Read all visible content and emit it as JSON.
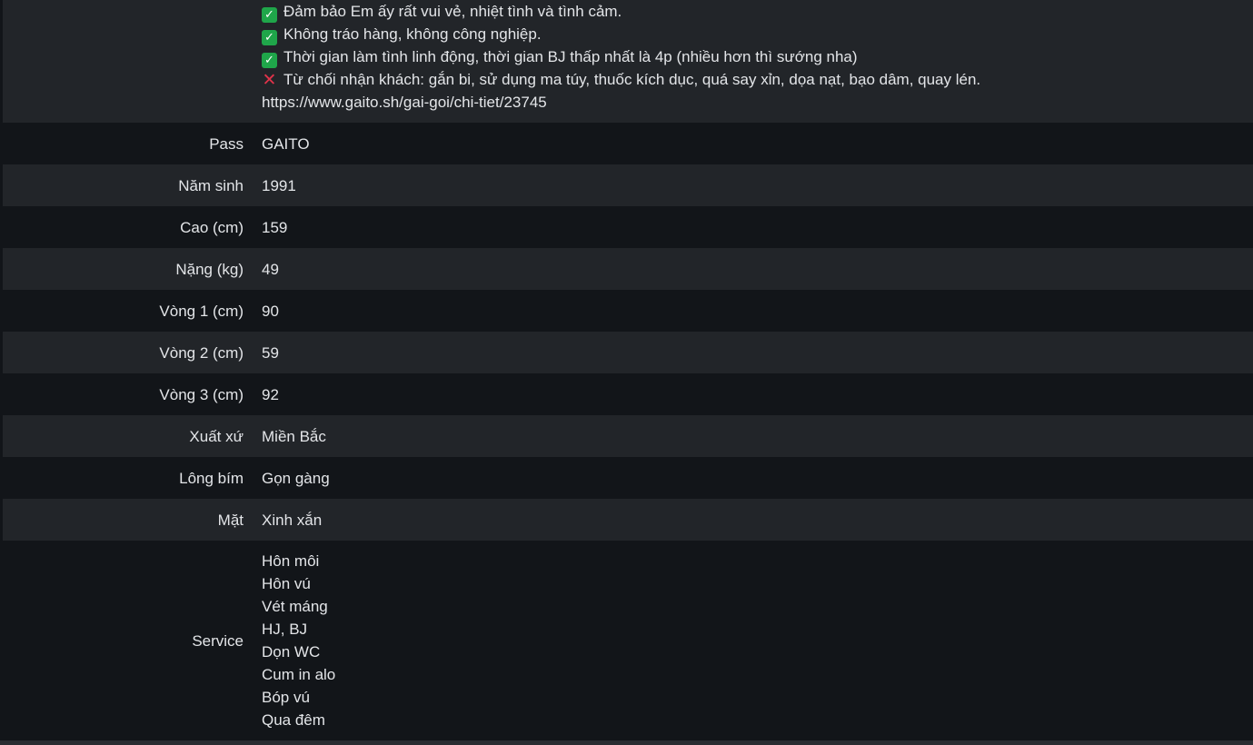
{
  "description": {
    "lines": [
      {
        "icon": "check",
        "text": "Đảm bảo Em ấy rất vui vẻ, nhiệt tình và tình cảm."
      },
      {
        "icon": "check",
        "text": "Không tráo hàng, không công nghiệp."
      },
      {
        "icon": "check",
        "text": "Thời gian làm tình linh động, thời gian BJ thấp nhất là 4p (nhiều hơn thì sướng nha)"
      },
      {
        "icon": "cross",
        "text": "Từ chối nhận khách: gắn bi, sử dụng ma túy, thuốc kích dục, quá say xỉn, dọa nạt, bạo dâm, quay lén."
      },
      {
        "icon": "",
        "text": "https://www.gaito.sh/gai-goi/chi-tiet/23745"
      }
    ]
  },
  "details": [
    {
      "label": "Pass",
      "value": "GAITO"
    },
    {
      "label": "Năm sinh",
      "value": "1991"
    },
    {
      "label": "Cao (cm)",
      "value": "159"
    },
    {
      "label": "Nặng (kg)",
      "value": "49"
    },
    {
      "label": "Vòng 1 (cm)",
      "value": "90"
    },
    {
      "label": "Vòng 2 (cm)",
      "value": "59"
    },
    {
      "label": "Vòng 3 (cm)",
      "value": "92"
    },
    {
      "label": "Xuất xứ",
      "value": "Miền Bắc"
    },
    {
      "label": "Lông bím",
      "value": "Gọn gàng"
    },
    {
      "label": "Mặt",
      "value": "Xinh xắn"
    }
  ],
  "service": {
    "label": "Service",
    "items": [
      "Hôn môi",
      "Hôn vú",
      "Vét máng",
      "HJ, BJ",
      "Dọn WC",
      "Cum in alo",
      "Bóp vú",
      "Qua đêm"
    ]
  },
  "colors": {
    "background": "#121519",
    "row_alt": "#222529",
    "text": "#e3e5e8",
    "check_green": "#1fa64a",
    "cross_red": "#e0334a"
  },
  "icons": {
    "check": "check-mark-icon",
    "cross": "cross-mark-icon"
  }
}
